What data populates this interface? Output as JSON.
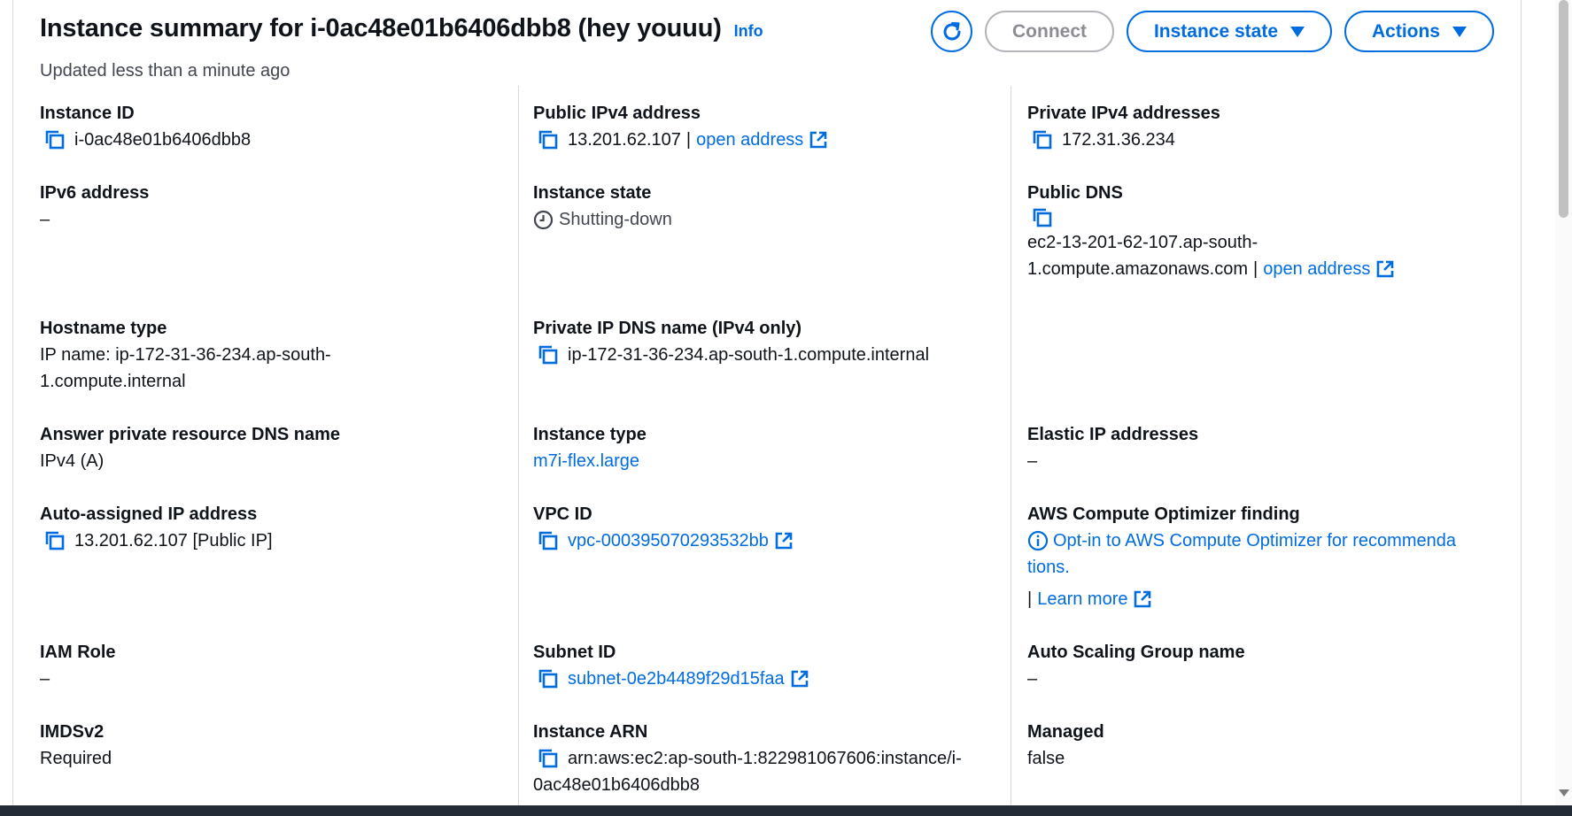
{
  "header": {
    "title": "Instance summary for i-0ac48e01b6406dbb8 (hey youuu)",
    "info_label": "Info",
    "updated": "Updated less than a minute ago"
  },
  "toolbar": {
    "refresh_icon": "refresh-icon",
    "connect_label": "Connect",
    "instance_state_label": "Instance state",
    "actions_label": "Actions"
  },
  "colors": {
    "accent": "#006ce0",
    "border": "#d5dbdb",
    "disabled": "#8c8c94"
  },
  "fields": {
    "instance_id": {
      "label": "Instance ID",
      "value": "i-0ac48e01b6406dbb8"
    },
    "public_ipv4": {
      "label": "Public IPv4 address",
      "value": "13.201.62.107",
      "link": "open address"
    },
    "private_ipv4": {
      "label": "Private IPv4 addresses",
      "value": "172.31.36.234"
    },
    "ipv6": {
      "label": "IPv6 address",
      "value": "–"
    },
    "instance_state": {
      "label": "Instance state",
      "value": "Shutting-down"
    },
    "public_dns": {
      "label": "Public DNS",
      "value_line1": "ec2-13-201-62-107.ap-south-",
      "value_line2": "1.compute.amazonaws.com",
      "link": "open address"
    },
    "hostname_type": {
      "label": "Hostname type",
      "value_line1": "IP name: ip-172-31-36-234.ap-south-",
      "value_line2": "1.compute.internal"
    },
    "private_ip_dns": {
      "label": "Private IP DNS name (IPv4 only)",
      "value": "ip-172-31-36-234.ap-south-1.compute.internal"
    },
    "answer_dns": {
      "label": "Answer private resource DNS name",
      "value": "IPv4 (A)"
    },
    "instance_type": {
      "label": "Instance type",
      "value": "m7i-flex.large"
    },
    "elastic_ip": {
      "label": "Elastic IP addresses",
      "value": "–"
    },
    "auto_ip": {
      "label": "Auto-assigned IP address",
      "value": "13.201.62.107 [Public IP]"
    },
    "vpc_id": {
      "label": "VPC ID",
      "value": "vpc-000395070293532bb"
    },
    "optimizer": {
      "label": "AWS Compute Optimizer finding",
      "link_line1": "Opt-in to AWS Compute Optimizer for recommenda",
      "link_line2": "tions.",
      "pipe": "|",
      "learn_more": "Learn more"
    },
    "iam_role": {
      "label": "IAM Role",
      "value": "–"
    },
    "subnet_id": {
      "label": "Subnet ID",
      "value": "subnet-0e2b4489f29d15faa"
    },
    "asg_name": {
      "label": "Auto Scaling Group name",
      "value": "–"
    },
    "imdsv2": {
      "label": "IMDSv2",
      "value": "Required"
    },
    "instance_arn": {
      "label": "Instance ARN",
      "value_line1": "arn:aws:ec2:ap-south-1:822981067606:instance/i-",
      "value_line2": "0ac48e01b6406dbb8"
    },
    "managed": {
      "label": "Managed",
      "value": "false"
    }
  }
}
